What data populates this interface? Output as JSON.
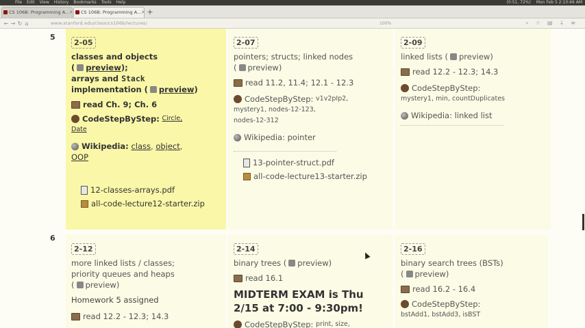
{
  "menubar": {
    "items": [
      "File",
      "Edit",
      "View",
      "History",
      "Bookmarks",
      "Tools",
      "Help"
    ],
    "battery": "(0:51, 72%)",
    "clock": "Mon Feb 5  2:10:46 AM"
  },
  "tabs": [
    {
      "title": "CS 106B: Programming A...",
      "active": false
    },
    {
      "title": "CS 106B: Programming A...",
      "active": true
    }
  ],
  "nav": {
    "url": "www.stanford.edu/class/cs106b/lectures/",
    "zoom": "100%"
  },
  "weeks": [
    {
      "number": "5"
    },
    {
      "number": "6"
    }
  ],
  "w5": {
    "mon": {
      "date": "2-05",
      "title_line1": "classes and objects",
      "preview": "preview",
      "title_line3": "arrays and",
      "mono_word": "Stack",
      "title_line4": "implementation (",
      "preview2": "preview",
      "read": "read Ch. 9; Ch. 6",
      "csbs_label": "CodeStepByStep:",
      "csbs_items": [
        "Circle,",
        "Date"
      ],
      "wiki_label": "Wikipedia:",
      "wiki_items": [
        "class",
        "object",
        "OOP"
      ],
      "files": [
        "12-classes-arrays.pdf",
        "all-code-lecture12-starter.zip"
      ]
    },
    "wed": {
      "date": "2-07",
      "title": "pointers; structs; linked nodes",
      "preview": "preview",
      "read": "read 11.2, 11.4; 12.1 - 12.3",
      "csbs_label": "CodeStepByStep:",
      "csbs_items": [
        "v1v2pIp2,",
        "mystery1,",
        "nodes-12-123,",
        "nodes-12-312"
      ],
      "wiki_label": "Wikipedia:",
      "wiki_item": "pointer",
      "files": [
        "13-pointer-struct.pdf",
        "all-code-lecture13-starter.zip"
      ]
    },
    "fri": {
      "date": "2-09",
      "title": "linked lists (",
      "preview": "preview",
      "read": "read 12.2 - 12.3; 14.3",
      "csbs_label": "CodeStepByStep:",
      "csbs_items": [
        "mystery1,",
        "min,",
        "countDuplicates"
      ],
      "wiki_label": "Wikipedia:",
      "wiki_item": "linked list"
    }
  },
  "w6": {
    "mon": {
      "date": "2-12",
      "title_line1": "more linked lists / classes;",
      "title_line2": "priority queues and heaps",
      "preview": "preview",
      "homework": "Homework 5 assigned",
      "read": "read 12.2 - 12.3; 14.3"
    },
    "wed": {
      "date": "2-14",
      "title": "binary trees (",
      "preview": "preview",
      "read": "read 16.1",
      "exam_line1": "MIDTERM EXAM is Thu",
      "exam_line2": "2/15 at 7:00 - 9:30pm!",
      "csbs_label": "CodeStepByStep:",
      "csbs_items": "print, size,"
    },
    "fri": {
      "date": "2-16",
      "title": "binary search trees (BSTs)",
      "preview": "preview",
      "read": "read 16.2 - 16.4",
      "csbs_label": "CodeStepByStep:",
      "csbs_items": [
        "bstAdd1,",
        "bstAdd3,",
        "isBST"
      ]
    }
  }
}
